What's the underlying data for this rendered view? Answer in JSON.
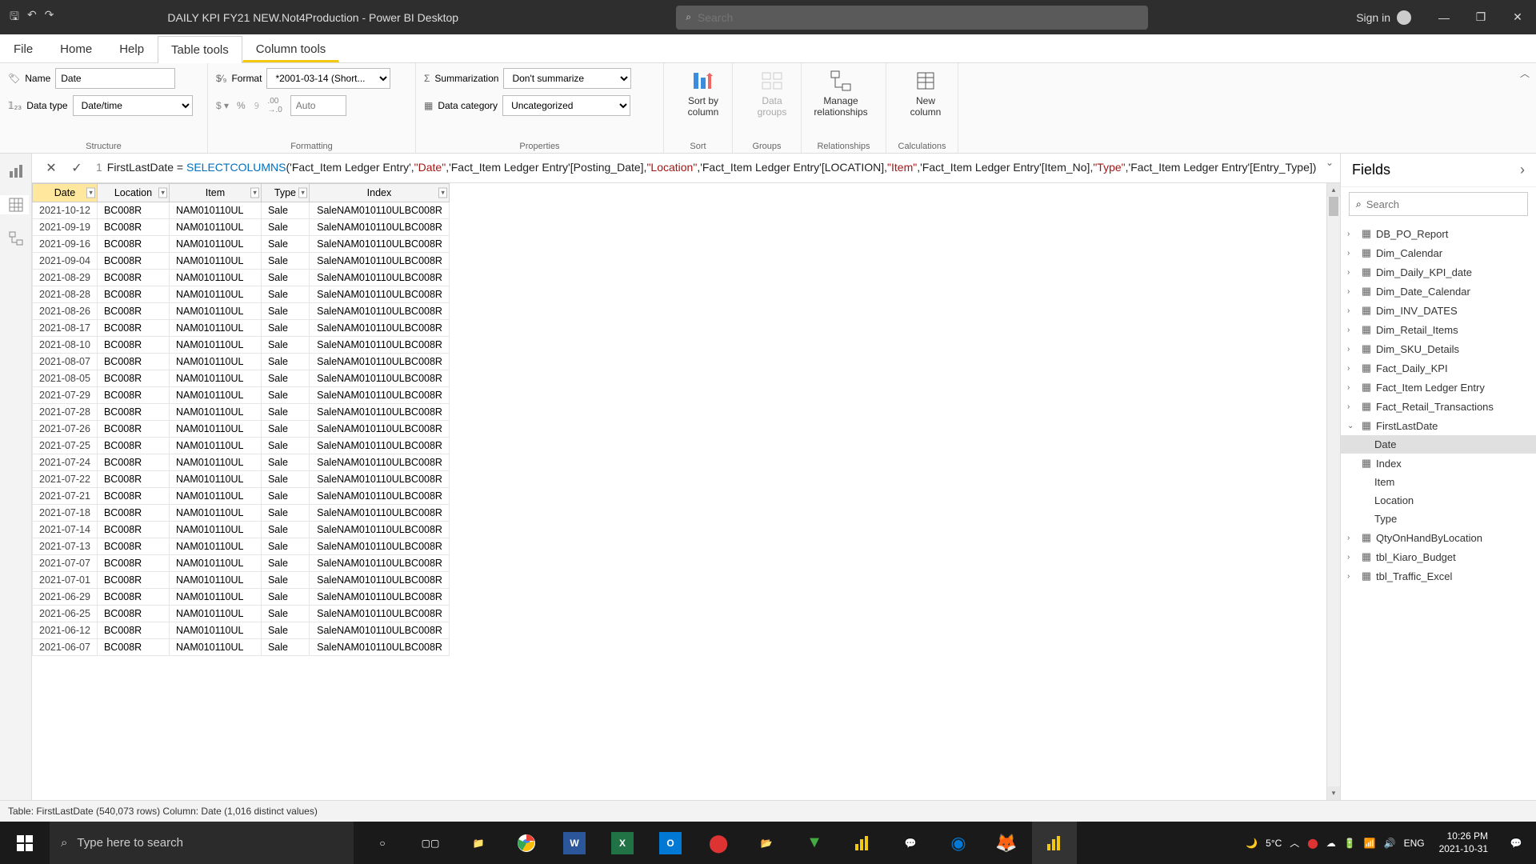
{
  "titlebar": {
    "title": "DAILY KPI FY21 NEW.Not4Production - Power BI Desktop",
    "search_placeholder": "Search",
    "signin": "Sign in"
  },
  "menu": {
    "file": "File",
    "home": "Home",
    "help": "Help",
    "table_tools": "Table tools",
    "column_tools": "Column tools"
  },
  "ribbon": {
    "structure": {
      "name_label": "Name",
      "name_value": "Date",
      "datatype_label": "Data type",
      "datatype_value": "Date/time",
      "group": "Structure"
    },
    "formatting": {
      "format_label": "Format",
      "format_value": "*2001-03-14 (Short...",
      "decimals_placeholder": "Auto",
      "group": "Formatting"
    },
    "properties": {
      "summarization_label": "Summarization",
      "summarization_value": "Don't summarize",
      "category_label": "Data category",
      "category_value": "Uncategorized",
      "group": "Properties"
    },
    "sort": {
      "label": "Sort by\ncolumn",
      "group": "Sort"
    },
    "groups": {
      "label": "Data\ngroups",
      "group": "Groups"
    },
    "relationships": {
      "label": "Manage\nrelationships",
      "group": "Relationships"
    },
    "calculations": {
      "label": "New\ncolumn",
      "group": "Calculations"
    }
  },
  "formula": {
    "line_no": "1",
    "prefix": "FirstLastDate = ",
    "fn": "SELECTCOLUMNS",
    "args_a": "(",
    "s1": "'Fact_Item Ledger Entry'",
    "c1": ",",
    "s2": "\"Date\"",
    "c2": ",",
    "s3": "'Fact_Item Ledger Entry'[Posting_Date]",
    "c3": ",",
    "s4": "\"Location\"",
    "c4": ",",
    "s5": "'Fact_Item Ledger Entry'[LOCATION]",
    "c5": ",",
    "s6": "\"Item\"",
    "c6": ",",
    "s7": "'Fact_Item Ledger Entry'[Item_No]",
    "c7": ",",
    "s8": "\"Type\"",
    "c8": ",",
    "s9": "'Fact_Item Ledger Entry'[Entry_Type]",
    "args_b": ")"
  },
  "columns": [
    "Date",
    "Location",
    "Item",
    "Type",
    "Index"
  ],
  "rows": [
    [
      "2021-10-12",
      "BC008R",
      "NAM010110UL",
      "Sale",
      "SaleNAM010110ULBC008R"
    ],
    [
      "2021-09-19",
      "BC008R",
      "NAM010110UL",
      "Sale",
      "SaleNAM010110ULBC008R"
    ],
    [
      "2021-09-16",
      "BC008R",
      "NAM010110UL",
      "Sale",
      "SaleNAM010110ULBC008R"
    ],
    [
      "2021-09-04",
      "BC008R",
      "NAM010110UL",
      "Sale",
      "SaleNAM010110ULBC008R"
    ],
    [
      "2021-08-29",
      "BC008R",
      "NAM010110UL",
      "Sale",
      "SaleNAM010110ULBC008R"
    ],
    [
      "2021-08-28",
      "BC008R",
      "NAM010110UL",
      "Sale",
      "SaleNAM010110ULBC008R"
    ],
    [
      "2021-08-26",
      "BC008R",
      "NAM010110UL",
      "Sale",
      "SaleNAM010110ULBC008R"
    ],
    [
      "2021-08-17",
      "BC008R",
      "NAM010110UL",
      "Sale",
      "SaleNAM010110ULBC008R"
    ],
    [
      "2021-08-10",
      "BC008R",
      "NAM010110UL",
      "Sale",
      "SaleNAM010110ULBC008R"
    ],
    [
      "2021-08-07",
      "BC008R",
      "NAM010110UL",
      "Sale",
      "SaleNAM010110ULBC008R"
    ],
    [
      "2021-08-05",
      "BC008R",
      "NAM010110UL",
      "Sale",
      "SaleNAM010110ULBC008R"
    ],
    [
      "2021-07-29",
      "BC008R",
      "NAM010110UL",
      "Sale",
      "SaleNAM010110ULBC008R"
    ],
    [
      "2021-07-28",
      "BC008R",
      "NAM010110UL",
      "Sale",
      "SaleNAM010110ULBC008R"
    ],
    [
      "2021-07-26",
      "BC008R",
      "NAM010110UL",
      "Sale",
      "SaleNAM010110ULBC008R"
    ],
    [
      "2021-07-25",
      "BC008R",
      "NAM010110UL",
      "Sale",
      "SaleNAM010110ULBC008R"
    ],
    [
      "2021-07-24",
      "BC008R",
      "NAM010110UL",
      "Sale",
      "SaleNAM010110ULBC008R"
    ],
    [
      "2021-07-22",
      "BC008R",
      "NAM010110UL",
      "Sale",
      "SaleNAM010110ULBC008R"
    ],
    [
      "2021-07-21",
      "BC008R",
      "NAM010110UL",
      "Sale",
      "SaleNAM010110ULBC008R"
    ],
    [
      "2021-07-18",
      "BC008R",
      "NAM010110UL",
      "Sale",
      "SaleNAM010110ULBC008R"
    ],
    [
      "2021-07-14",
      "BC008R",
      "NAM010110UL",
      "Sale",
      "SaleNAM010110ULBC008R"
    ],
    [
      "2021-07-13",
      "BC008R",
      "NAM010110UL",
      "Sale",
      "SaleNAM010110ULBC008R"
    ],
    [
      "2021-07-07",
      "BC008R",
      "NAM010110UL",
      "Sale",
      "SaleNAM010110ULBC008R"
    ],
    [
      "2021-07-01",
      "BC008R",
      "NAM010110UL",
      "Sale",
      "SaleNAM010110ULBC008R"
    ],
    [
      "2021-06-29",
      "BC008R",
      "NAM010110UL",
      "Sale",
      "SaleNAM010110ULBC008R"
    ],
    [
      "2021-06-25",
      "BC008R",
      "NAM010110UL",
      "Sale",
      "SaleNAM010110ULBC008R"
    ],
    [
      "2021-06-12",
      "BC008R",
      "NAM010110UL",
      "Sale",
      "SaleNAM010110ULBC008R"
    ],
    [
      "2021-06-07",
      "BC008R",
      "NAM010110UL",
      "Sale",
      "SaleNAM010110ULBC008R"
    ]
  ],
  "fields": {
    "title": "Fields",
    "search_placeholder": "Search",
    "tables": [
      {
        "name": "DB_PO_Report",
        "expanded": false
      },
      {
        "name": "Dim_Calendar",
        "expanded": false
      },
      {
        "name": "Dim_Daily_KPI_date",
        "expanded": false
      },
      {
        "name": "Dim_Date_Calendar",
        "expanded": false
      },
      {
        "name": "Dim_INV_DATES",
        "expanded": false
      },
      {
        "name": "Dim_Retail_Items",
        "expanded": false
      },
      {
        "name": "Dim_SKU_Details",
        "expanded": false
      },
      {
        "name": "Fact_Daily_KPI",
        "expanded": false
      },
      {
        "name": "Fact_Item Ledger Entry",
        "expanded": false
      },
      {
        "name": "Fact_Retail_Transactions",
        "expanded": false
      },
      {
        "name": "FirstLastDate",
        "expanded": true,
        "children": [
          {
            "name": "Date",
            "selected": true
          },
          {
            "name": "Index"
          },
          {
            "name": "Item"
          },
          {
            "name": "Location"
          },
          {
            "name": "Type"
          }
        ]
      },
      {
        "name": "QtyOnHandByLocation",
        "expanded": false
      },
      {
        "name": "tbl_Kiaro_Budget",
        "expanded": false
      },
      {
        "name": "tbl_Traffic_Excel",
        "expanded": false
      }
    ]
  },
  "status": "Table: FirstLastDate (540,073 rows) Column: Date (1,016 distinct values)",
  "taskbar": {
    "search_placeholder": "Type here to search",
    "temp": "5°C",
    "lang": "ENG",
    "time": "10:26 PM",
    "date": "2021-10-31"
  }
}
